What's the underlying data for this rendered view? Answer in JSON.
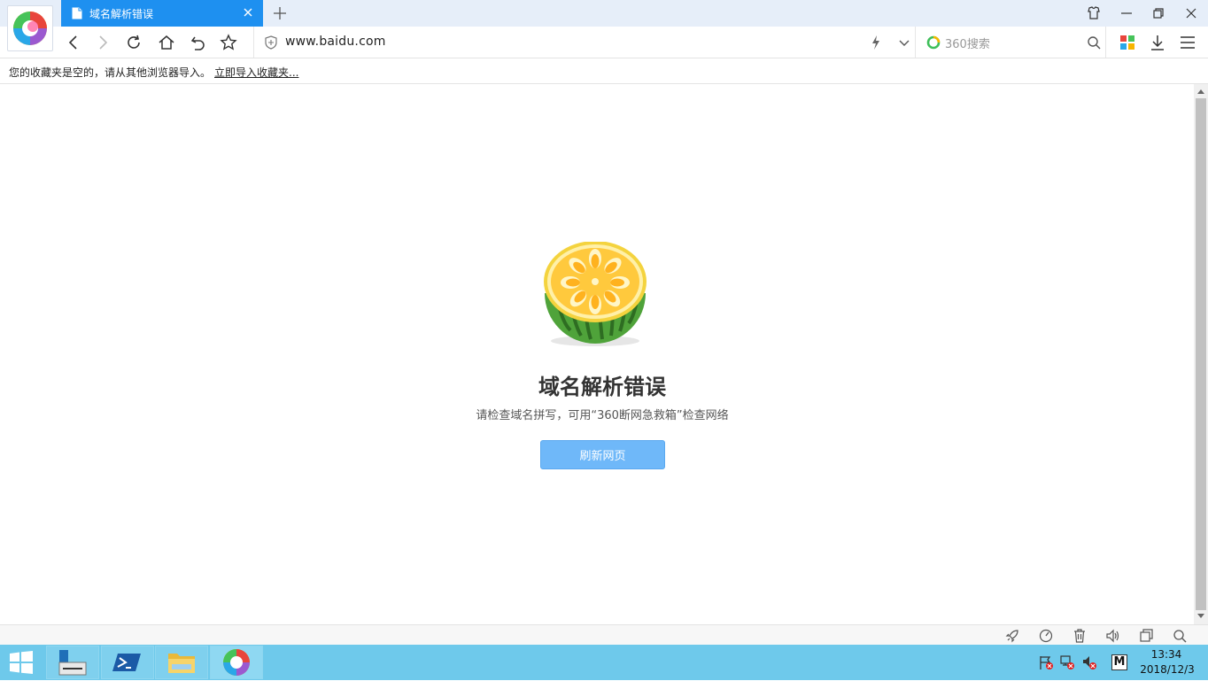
{
  "browser": {
    "tab": {
      "title": "域名解析错误"
    },
    "address": {
      "url": "www.baidu.com"
    },
    "search": {
      "placeholder": "360搜索"
    }
  },
  "bookmarks": {
    "empty_message": "您的收藏夹是空的，请从其他浏览器导入。",
    "import_link": "立即导入收藏夹..."
  },
  "error_page": {
    "title": "域名解析错误",
    "description": "请检查域名拼写，可用“360断网急救箱”检查网络",
    "refresh_button": "刷新网页"
  },
  "taskbar": {
    "time": "13:34",
    "date": "2018/12/3",
    "ime_label": "M"
  },
  "colors": {
    "tab_active": "#1e90f0",
    "button": "#6fb8f9",
    "taskbar": "#6ec9eb"
  }
}
